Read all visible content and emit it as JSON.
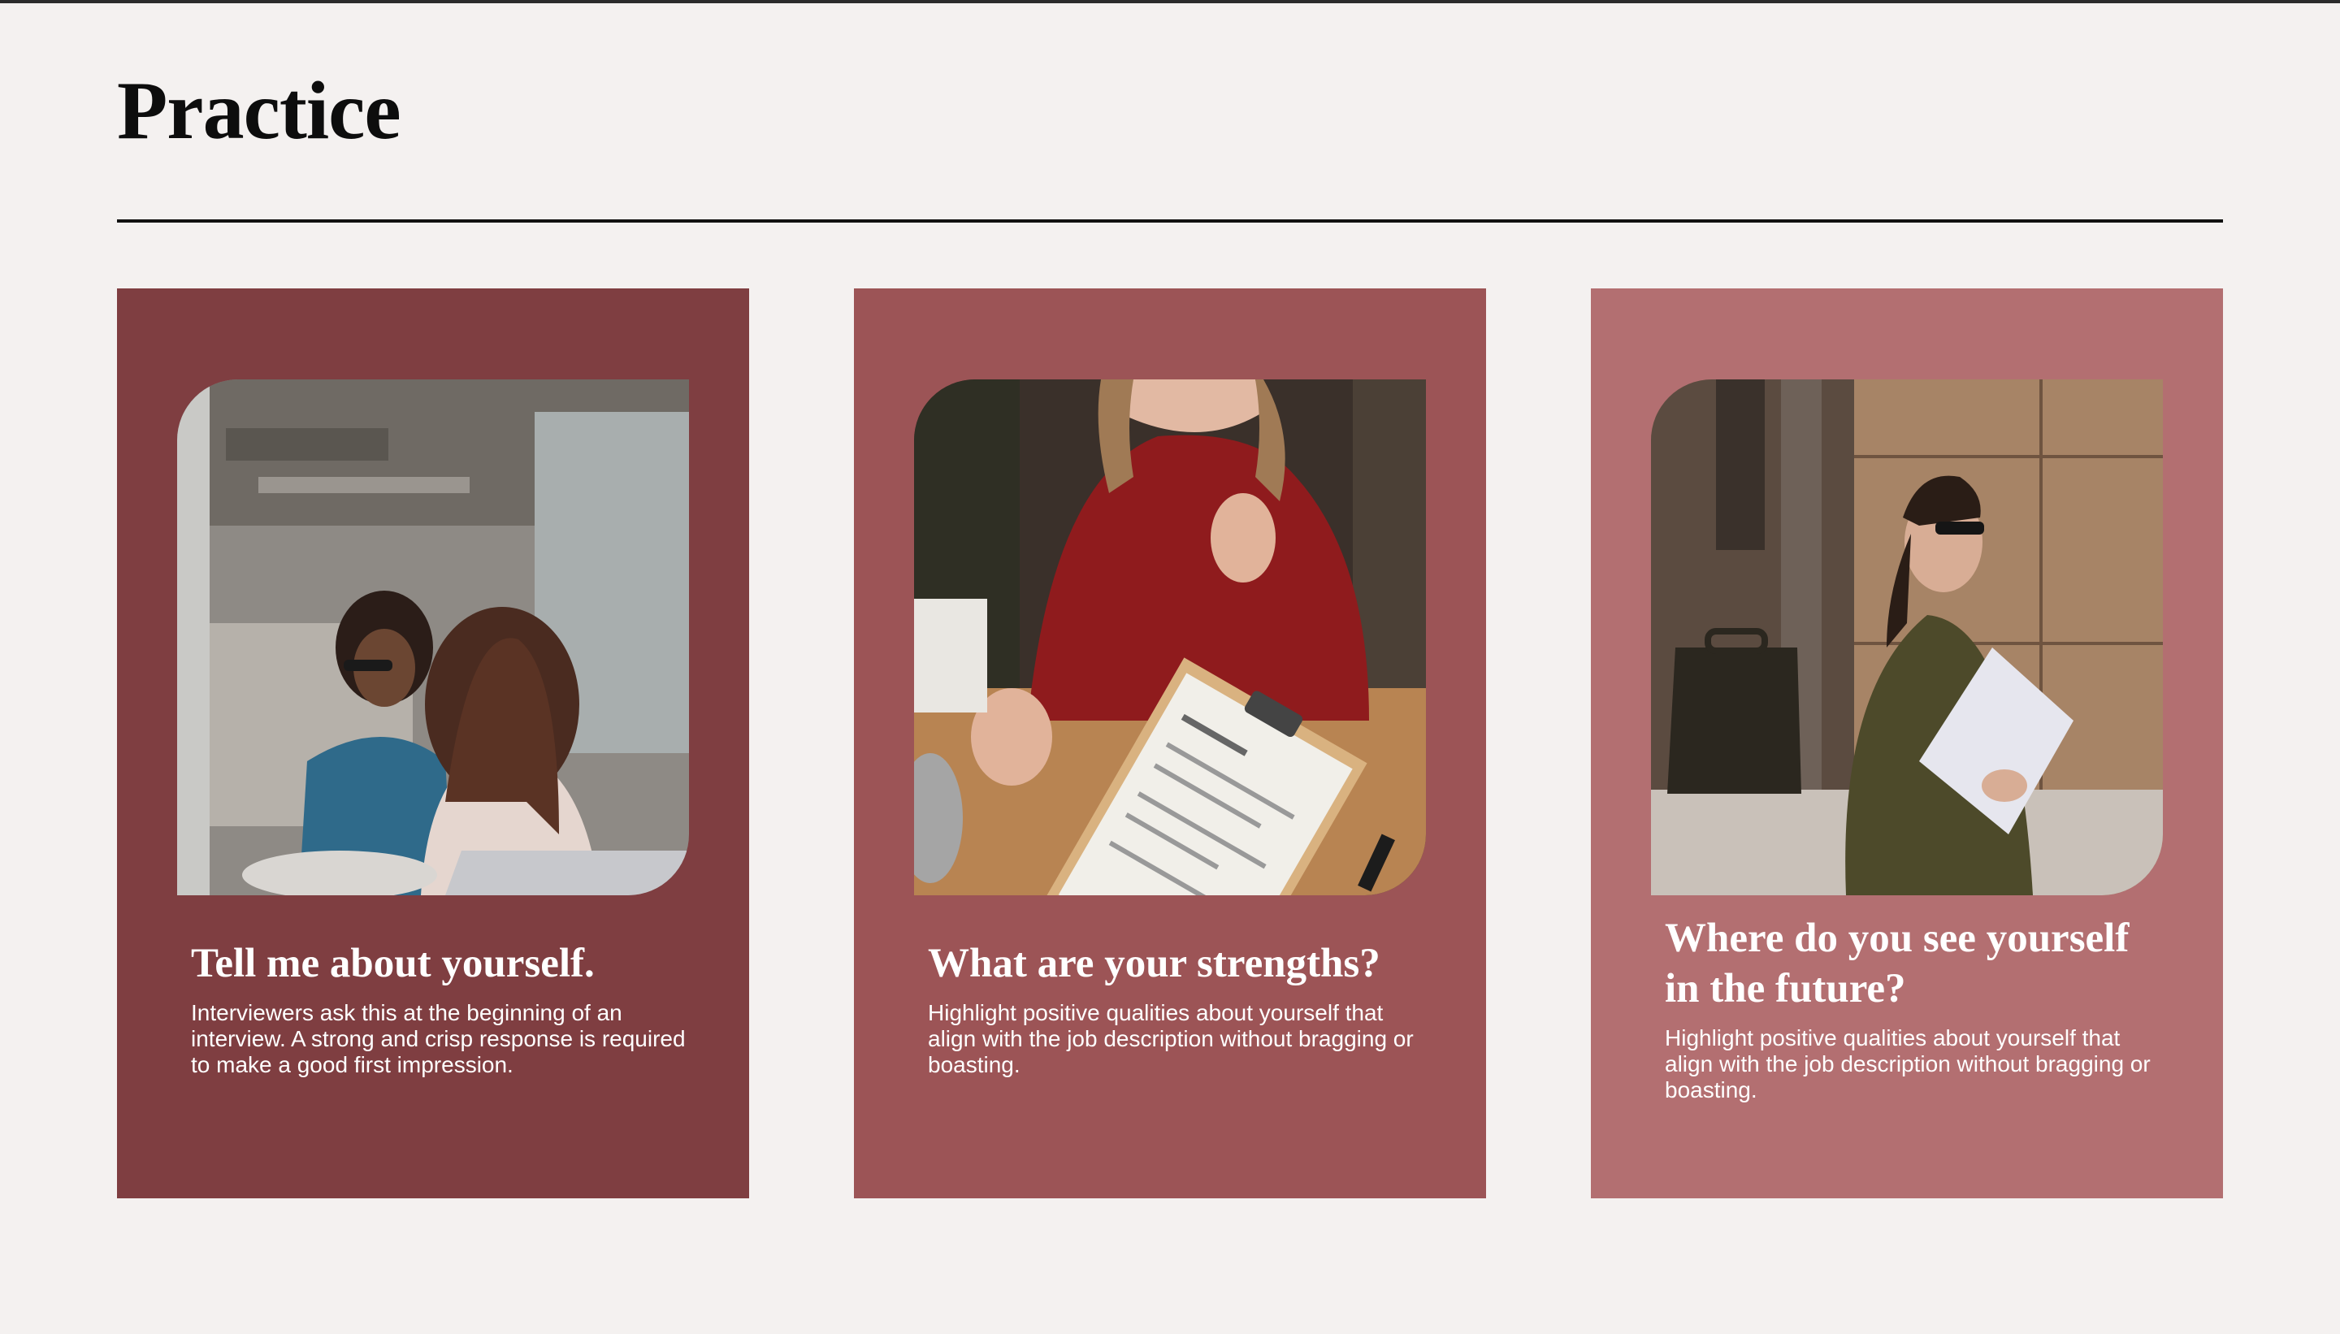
{
  "slide": {
    "title": "Practice"
  },
  "colors": {
    "background": "#f4f1f0",
    "card_1": "#7f3e41",
    "card_2": "#9c5456",
    "card_3": "#b36f71",
    "text_light": "#ffffff"
  },
  "cards": [
    {
      "heading": "Tell me about yourself.",
      "description": "Interviewers ask this at the beginning of an interview. A strong and crisp response is required to make a good first impression."
    },
    {
      "heading": "What are your strengths?",
      "description": "Highlight positive qualities about yourself that align with the job description without bragging or boasting."
    },
    {
      "heading": "Where do you see yourself in the future?",
      "description": "Highlight positive qualities about yourself that align with the job description without bragging or boasting."
    }
  ]
}
